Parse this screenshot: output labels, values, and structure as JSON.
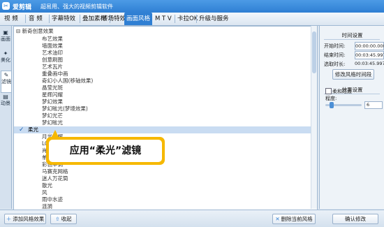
{
  "app": {
    "name": "爱剪辑",
    "slogan": "超易用、强大的视频剪辑软件",
    "logo_icon": "scissors-logo-icon"
  },
  "menu": [
    {
      "label": "视  频"
    },
    {
      "label": "音  频"
    },
    {
      "label": "字幕特效"
    },
    {
      "label": "叠加素材"
    },
    {
      "label": "转场特效"
    },
    {
      "label": "画面风格",
      "active": true
    },
    {
      "label": "M T V"
    },
    {
      "label": "卡拉OK"
    },
    {
      "label": "升级与服务"
    }
  ],
  "side_tabs": [
    {
      "label": "画面",
      "icon": "image-icon"
    },
    {
      "label": "美化",
      "icon": "magic-wand-icon"
    },
    {
      "label": "滤镜",
      "icon": "filter-icon",
      "active": true
    },
    {
      "label": "动景",
      "icon": "motion-icon"
    }
  ],
  "list": {
    "root_label": "⊟ 新奇创意效果",
    "items": [
      "布艺效果",
      "墙面效果",
      "艺术油印",
      "创意刷图",
      "艺术瓦片",
      "重叠画中画",
      "奇幻小人国(移轴效果)",
      "晶莹光斑",
      "星辉闪耀",
      "梦幻效果",
      "梦幻眩光(梦境效果)",
      "梦幻光芒",
      "梦幻眩光",
      "柔光",
      "月光照耀",
      "LOMO效果",
      "肖像画",
      "单色丰调",
      "彩色丰调",
      "马赛克网格",
      "迷人万花筒",
      "散光",
      "风",
      "雨中水迹",
      "涟漪"
    ],
    "selected_index": 13,
    "selected_check": "✓"
  },
  "callout": {
    "text": "应用“柔光”滤镜"
  },
  "bottom_buttons": {
    "add_effect": "添加风格效果",
    "collect": "收起",
    "delete_effect": "删除当前风格",
    "confirm": "确认修改"
  },
  "time_settings": {
    "title": "时间设置",
    "start_label": "开始时间:",
    "start_value": "00:00:00.000",
    "end_label": "结束时间:",
    "end_value": "00:03:45.997",
    "duration_label": "选取时长:",
    "duration_value": "00:03:45.997",
    "sync_button": "修改风格时间段"
  },
  "effect_settings": {
    "title": "效果设置",
    "soft_transition_label": "柔和过渡",
    "degree_label": "程度:",
    "degree_value": "6",
    "degree_fraction": 0.12
  },
  "colors": {
    "accent": "#2f7fd3",
    "callout": "#f6b800",
    "selection": "#c9dcf2"
  }
}
